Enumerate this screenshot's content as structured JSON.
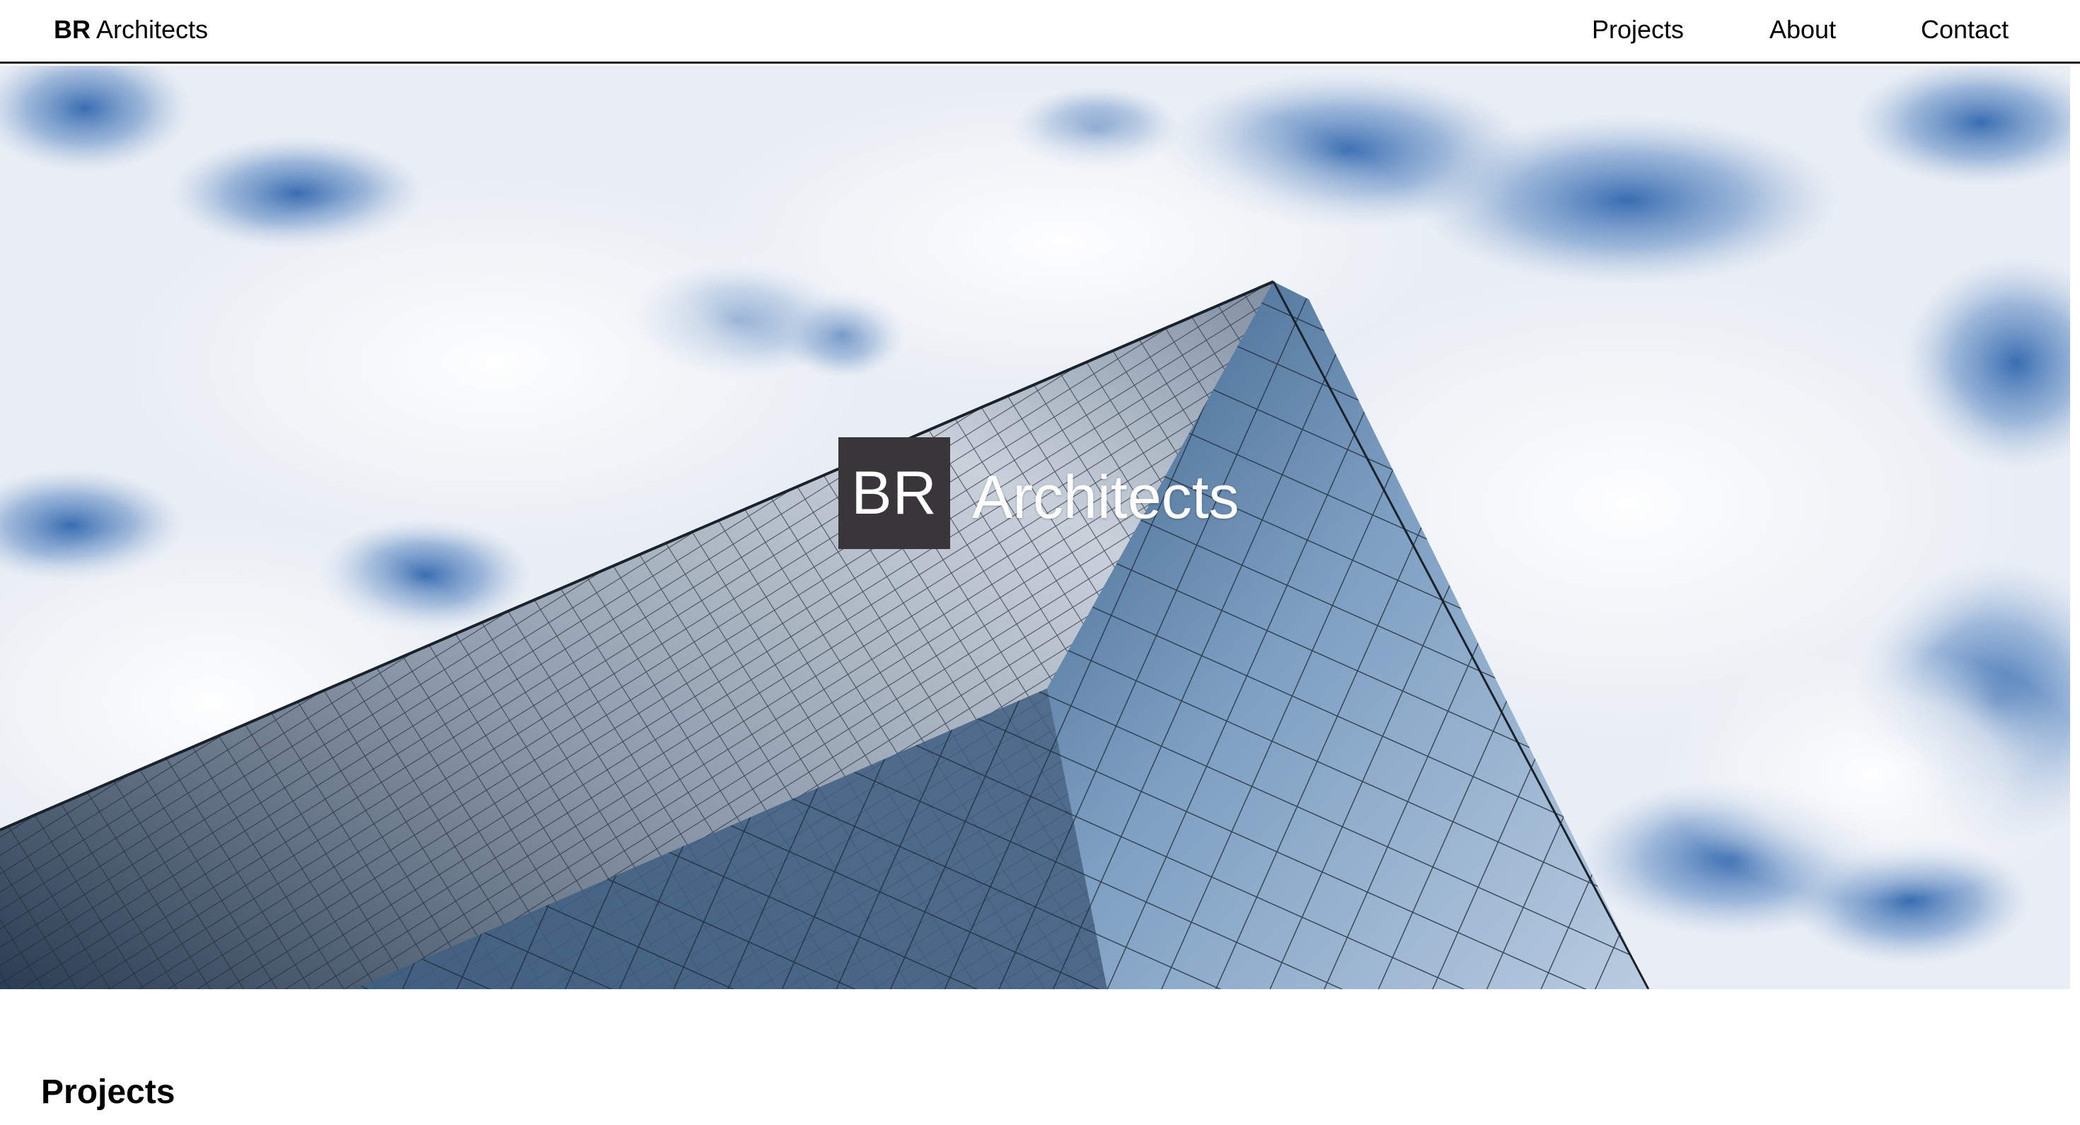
{
  "header": {
    "logo_bold": "BR",
    "logo_rest": " Architects",
    "nav": [
      {
        "label": "Projects"
      },
      {
        "label": "About"
      },
      {
        "label": "Contact"
      }
    ]
  },
  "hero": {
    "mark": "BR",
    "name": "Architects",
    "image": "glass skyscraper against cloudy blue sky"
  },
  "sections": {
    "projects_title": "Projects"
  },
  "colors": {
    "nav_border": "#1e1e1e",
    "mark_bg": "#383638",
    "sky": "#3a6fb0",
    "glass": "#2d4f72"
  }
}
